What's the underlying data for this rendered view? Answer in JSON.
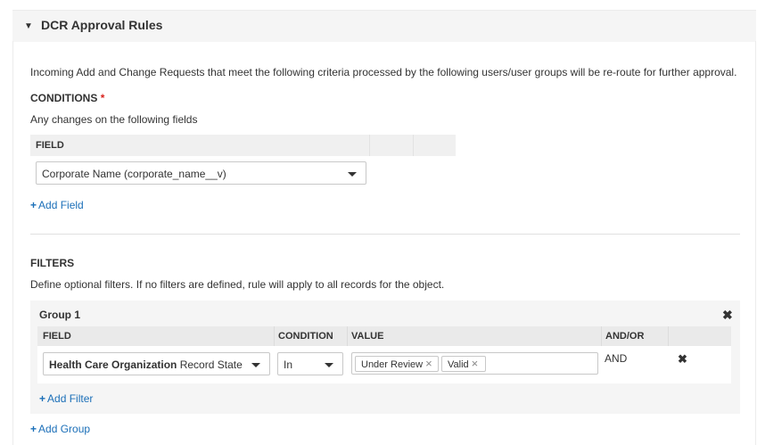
{
  "panel": {
    "toggle_glyph": "▼",
    "title": "DCR Approval Rules"
  },
  "description": "Incoming Add and Change Requests that meet the following criteria processed by the following users/user groups will be re-route for further approval.",
  "conditions": {
    "label": "CONDITIONS",
    "required_mark": "*",
    "subtitle": "Any changes on the following fields",
    "table_header": "FIELD",
    "field_value": "Corporate Name (corporate_name__v)",
    "add_field_label": "Add Field"
  },
  "filters": {
    "label": "FILTERS",
    "subtitle": "Define optional filters. If no filters are defined, rule will apply to all records for the object.",
    "group": {
      "title": "Group 1",
      "columns": [
        "FIELD",
        "CONDITION",
        "VALUE",
        "AND/OR"
      ],
      "row": {
        "field_object": "Health Care Organization",
        "field_name": "Record State",
        "condition": "In",
        "values": [
          "Under Review",
          "Valid"
        ],
        "and_or": "AND"
      },
      "add_filter_label": "Add Filter"
    },
    "add_group_label": "Add Group"
  },
  "icons": {
    "plus": "+",
    "remove": "✖",
    "tag_remove": "×"
  },
  "colors": {
    "link": "#1b6fb8",
    "required": "#d9221c",
    "header_bg": "#f5f5f5",
    "group_bg": "#f5f5f5"
  }
}
